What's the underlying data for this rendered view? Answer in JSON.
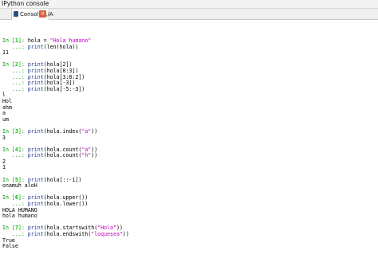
{
  "window": {
    "title": "IPython console"
  },
  "tabs": [
    {
      "label": "Console 1/A",
      "close_icon": "close-icon"
    }
  ],
  "console": {
    "entries": [
      {
        "prompt": "In [1]:",
        "inputs": [
          [
            {
              "t": "plain",
              "v": "hola = "
            },
            {
              "t": "str",
              "v": "\"Hola humano\""
            }
          ],
          [
            {
              "t": "kw",
              "v": "print"
            },
            {
              "t": "plain",
              "v": "(len(hola))"
            }
          ]
        ],
        "outputs": [
          "11"
        ]
      },
      {
        "prompt": "In [2]:",
        "inputs": [
          [
            {
              "t": "kw",
              "v": "print"
            },
            {
              "t": "plain",
              "v": "(hola[2])"
            }
          ],
          [
            {
              "t": "kw",
              "v": "print"
            },
            {
              "t": "plain",
              "v": "(hola[0:3])"
            }
          ],
          [
            {
              "t": "kw",
              "v": "print"
            },
            {
              "t": "plain",
              "v": "(hola[3:8:2])"
            }
          ],
          [
            {
              "t": "kw",
              "v": "print"
            },
            {
              "t": "plain",
              "v": "(hola[-3])"
            }
          ],
          [
            {
              "t": "kw",
              "v": "print"
            },
            {
              "t": "plain",
              "v": "(hola[-5:-3])"
            }
          ]
        ],
        "outputs": [
          "l",
          "Hol",
          "ahm",
          "a",
          "um"
        ]
      },
      {
        "prompt": "In [3]:",
        "inputs": [
          [
            {
              "t": "kw",
              "v": "print"
            },
            {
              "t": "plain",
              "v": "(hola.index("
            },
            {
              "t": "str",
              "v": "\"a\""
            },
            {
              "t": "plain",
              "v": "))"
            }
          ]
        ],
        "outputs": [
          "3"
        ]
      },
      {
        "prompt": "In [4]:",
        "inputs": [
          [
            {
              "t": "kw",
              "v": "print"
            },
            {
              "t": "plain",
              "v": "(hola.count("
            },
            {
              "t": "str",
              "v": "\"a\""
            },
            {
              "t": "plain",
              "v": "))"
            }
          ],
          [
            {
              "t": "kw",
              "v": "print"
            },
            {
              "t": "plain",
              "v": "(hola.count("
            },
            {
              "t": "str",
              "v": "\"h\""
            },
            {
              "t": "plain",
              "v": "))"
            }
          ]
        ],
        "outputs": [
          "2",
          "1"
        ]
      },
      {
        "prompt": "In [5]:",
        "inputs": [
          [
            {
              "t": "kw",
              "v": "print"
            },
            {
              "t": "plain",
              "v": "(hola[::-1])"
            }
          ]
        ],
        "outputs": [
          "onamuh aloH"
        ]
      },
      {
        "prompt": "In [6]:",
        "inputs": [
          [
            {
              "t": "kw",
              "v": "print"
            },
            {
              "t": "plain",
              "v": "(hola.upper())"
            }
          ],
          [
            {
              "t": "kw",
              "v": "print"
            },
            {
              "t": "plain",
              "v": "(hola.lower())"
            }
          ]
        ],
        "outputs": [
          "HOLA HUMANO",
          "hola humano"
        ]
      },
      {
        "prompt": "In [7]:",
        "inputs": [
          [
            {
              "t": "kw",
              "v": "print"
            },
            {
              "t": "plain",
              "v": "(hola.startswith("
            },
            {
              "t": "str",
              "v": "\"Hola\""
            },
            {
              "t": "plain",
              "v": "))"
            }
          ],
          [
            {
              "t": "kw",
              "v": "print"
            },
            {
              "t": "plain",
              "v": "(hola.endswith("
            },
            {
              "t": "str",
              "v": "\"loquesea\""
            },
            {
              "t": "plain",
              "v": "))"
            }
          ]
        ],
        "outputs": [
          "True",
          "False"
        ]
      }
    ],
    "continuation_prompt": "...:",
    "colors": {
      "prompt": "#00a000",
      "keyword": "#1f3d8f",
      "string": "#c000c0",
      "close_button": "#d9603b"
    }
  }
}
